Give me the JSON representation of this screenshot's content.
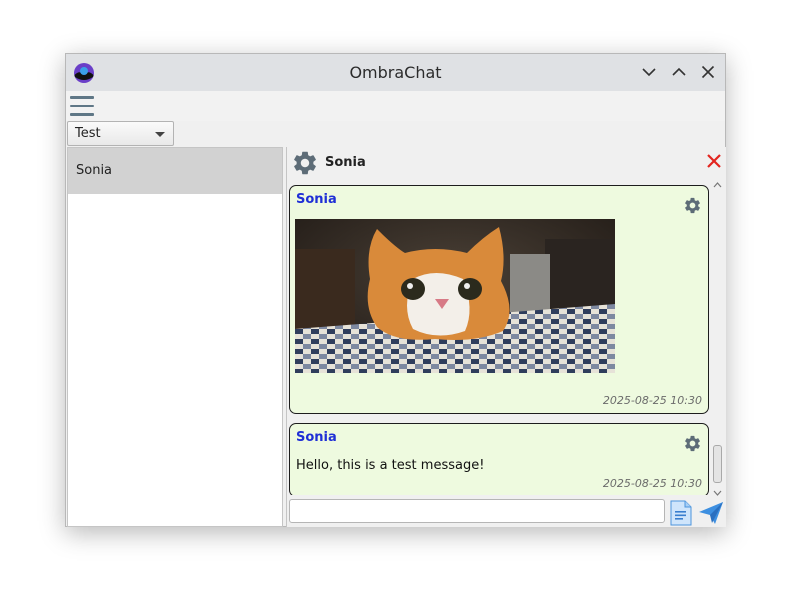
{
  "window": {
    "title": "OmbraChat"
  },
  "icons": {
    "app_logo": "ombrachat-logo",
    "minimize": "chevron-down-icon",
    "maximize": "chevron-up-icon",
    "close": "close-icon",
    "menu": "hamburger-menu-icon",
    "settings": "gear-icon",
    "close_chat": "close-red-x-icon",
    "attach": "file-icon",
    "send": "send-paper-plane-icon"
  },
  "colors": {
    "accent": "#1f2fd6",
    "message_bg": "#eefadf",
    "close_red": "#e3251f",
    "send_blue": "#3d8fe0"
  },
  "account_selector": {
    "selected": "Test"
  },
  "contacts": [
    {
      "name": "Sonia",
      "selected": true
    }
  ],
  "chat": {
    "title": "Sonia",
    "messages": [
      {
        "sender": "Sonia",
        "type": "image",
        "image": "photo of an orange and white cat peeking over a checkered tablecloth",
        "timestamp": "2025-08-25 10:30"
      },
      {
        "sender": "Sonia",
        "type": "text",
        "text": "Hello, this is a test message!",
        "timestamp": "2025-08-25 10:30"
      }
    ],
    "input": {
      "value": "",
      "placeholder": ""
    }
  }
}
